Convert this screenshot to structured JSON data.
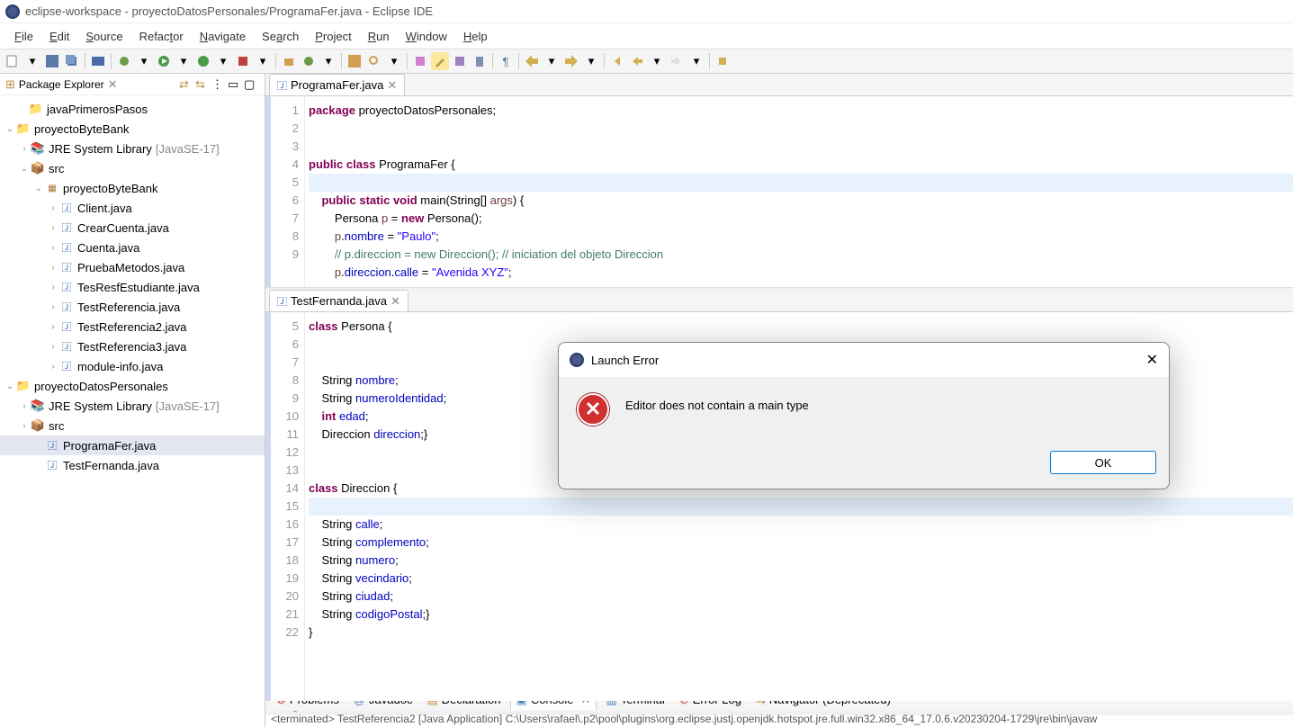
{
  "window_title": "eclipse-workspace - proyectoDatosPersonales/ProgramaFer.java - Eclipse IDE",
  "menu": [
    "File",
    "Edit",
    "Source",
    "Refactor",
    "Navigate",
    "Search",
    "Project",
    "Run",
    "Window",
    "Help"
  ],
  "package_explorer": {
    "title": "Package Explorer"
  },
  "tree": {
    "n0": "javaPrimerosPasos",
    "n1": "proyectoByteBank",
    "n2": "JRE System Library",
    "n2suffix": "[JavaSE-17]",
    "n3": "src",
    "n4": "proyectoByteBank",
    "f1": "Client.java",
    "f2": "CrearCuenta.java",
    "f3": "Cuenta.java",
    "f4": "PruebaMetodos.java",
    "f5": "TesResfEstudiante.java",
    "f6": "TestReferencia.java",
    "f7": "TestReferencia2.java",
    "f8": "TestReferencia3.java",
    "f9": "module-info.java",
    "n5": "proyectoDatosPersonales",
    "n6": "JRE System Library",
    "n6suffix": "[JavaSE-17]",
    "n7": "src",
    "f10": "ProgramaFer.java",
    "f11": "TestFernanda.java"
  },
  "editor1": {
    "tab": "ProgramaFer.java",
    "lines": [
      "1",
      "2",
      "3",
      "4",
      "5",
      "6",
      "7",
      "8",
      "9"
    ]
  },
  "code1": {
    "l1a": "package",
    "l1b": " proyectoDatosPersonales;",
    "l3a": "public",
    "l3b": "class",
    "l3c": " ProgramaFer {",
    "l5a": "public",
    "l5b": "static",
    "l5c": "void",
    "l5d": " main(String[] ",
    "l5e": "args",
    "l5f": ") {",
    "l6a": "        Persona ",
    "l6b": "p",
    "l6c": " = ",
    "l6d": "new",
    "l6e": " Persona();",
    "l7a": "        ",
    "l7b": "p",
    "l7c": ".",
    "l7d": "nombre",
    "l7e": " = ",
    "l7f": "\"Paulo\"",
    "l7g": ";",
    "l8": "        // p.direccion = new Direccion(); // iniciation del objeto Direccion",
    "l9a": "        ",
    "l9b": "p",
    "l9c": ".",
    "l9d": "direccion",
    "l9e": ".",
    "l9f": "calle",
    "l9g": " = ",
    "l9h": "\"Avenida XYZ\"",
    "l9i": ";"
  },
  "editor2": {
    "tab": "TestFernanda.java",
    "lines": [
      "5",
      "6",
      "7",
      "8",
      "9",
      "10",
      "11",
      "12",
      "13",
      "14",
      "15",
      "16",
      "17",
      "18",
      "19",
      "20",
      "21",
      "22"
    ]
  },
  "code2": {
    "l5a": "class",
    "l5b": " Persona {",
    "l7a": "    String ",
    "l7b": "nombre",
    "l7c": ";",
    "l8a": "    String ",
    "l8b": "numeroIdentidad",
    "l8c": ";",
    "l9a": "    ",
    "l9b": "int",
    "l9c": " ",
    "l9d": "edad",
    "l9e": ";",
    "l10a": "    Direccion ",
    "l10b": "direccion",
    "l10c": ";}",
    "l12a": "class",
    "l12b": " Direccion {",
    "l14a": "    String ",
    "l14b": "calle",
    "l14c": ";",
    "l15a": "    String ",
    "l15b": "complemento",
    "l15c": ";",
    "l16a": "    String ",
    "l16b": "numero",
    "l16c": ";",
    "l17a": "    String ",
    "l17b": "vecindario",
    "l17c": ";",
    "l18a": "    String ",
    "l18b": "ciudad",
    "l18c": ";",
    "l19a": "    String ",
    "l19b": "codigoPostal",
    "l19c": ";}",
    "l20": "}"
  },
  "bottom_tabs": {
    "problems": "Problems",
    "javadoc": "Javadoc",
    "declaration": "Declaration",
    "console": "Console",
    "terminal": "Terminal",
    "errorlog": "Error Log",
    "navigator": "Navigator (Deprecated)"
  },
  "console_text": "<terminated> TestReferencia2 [Java Application] C:\\Users\\rafael\\.p2\\pool\\plugins\\org.eclipse.justj.openjdk.hotspot.jre.full.win32.x86_64_17.0.6.v20230204-1729\\jre\\bin\\javaw",
  "dialog": {
    "title": "Launch Error",
    "message": "Editor does not contain a main type",
    "ok": "OK"
  }
}
